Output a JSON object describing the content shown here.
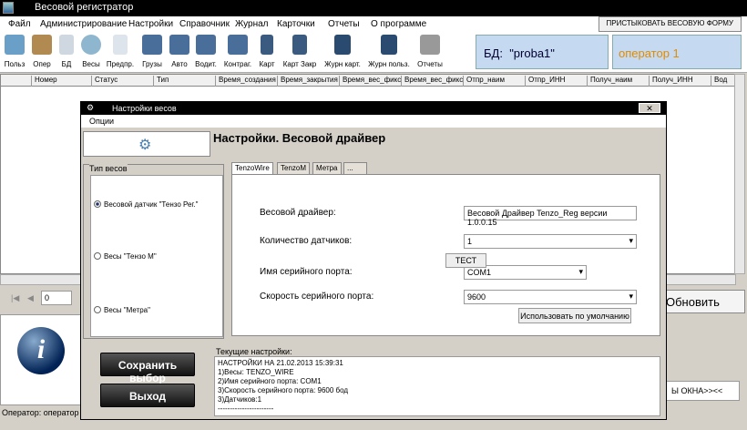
{
  "app": {
    "title": "Весовой регистратор"
  },
  "menu": [
    "Файл",
    "Администрирование",
    "Настройки",
    "Справочник",
    "Журнал",
    "Карточки",
    "Отчеты",
    "О программе"
  ],
  "pin_button": "ПРИСТЫКОВАТЬ ВЕСОВУЮ ФОРМУ",
  "toolbar": [
    {
      "label": "Польз",
      "icon": "users-icon"
    },
    {
      "label": "Опер",
      "icon": "operator-icon"
    },
    {
      "label": "БД",
      "icon": "database-icon"
    },
    {
      "label": "Весы",
      "icon": "scales-gear-icon"
    },
    {
      "label": "Предпр.",
      "icon": "enterprise-icon"
    },
    {
      "label": "Грузы",
      "icon": "cargo-icon"
    },
    {
      "label": "Авто",
      "icon": "auto-icon"
    },
    {
      "label": "Водит.",
      "icon": "driver-icon"
    },
    {
      "label": "Контраг.",
      "icon": "counterparty-icon"
    },
    {
      "label": "Карт",
      "icon": "card-icon"
    },
    {
      "label": "Карт Закр",
      "icon": "card-closed-icon"
    },
    {
      "label": "Журн карт.",
      "icon": "card-journal-icon"
    },
    {
      "label": "Журн польз.",
      "icon": "user-journal-icon"
    },
    {
      "label": "Отчеты",
      "icon": "printer-icon"
    }
  ],
  "db": {
    "label": "БД:",
    "value": "\"proba1\""
  },
  "operator": {
    "value": "оператор 1"
  },
  "grid": {
    "columns": [
      "Номер",
      "Статус",
      "Тип",
      "Время_создания",
      "Время_закрытия",
      "Время_вес_фиксе",
      "Время_вес_фиксе",
      "Отпр_наим",
      "Отпр_ИНН",
      "Получ_наим",
      "Получ_ИНН",
      "Вод"
    ]
  },
  "nav": {
    "page": "0",
    "refresh": "Обновить"
  },
  "status": {
    "operator": "Оператор: оператор"
  },
  "bottom_right": "Ы ОКНА>><<",
  "dialog": {
    "title": "Настройки весов",
    "menu": "Опции",
    "heading": "Настройки.  Весовой драйвер",
    "type_legend": "Тип весов",
    "types": [
      {
        "label": "Весовой датчик \"Тензо Рег.\"",
        "selected": true
      },
      {
        "label": "Весы \"Тензо М\"",
        "selected": false
      },
      {
        "label": "Весы \"Метра\"",
        "selected": false
      }
    ],
    "tabs": [
      "TenzoWire",
      "TenzoM",
      "Метра",
      "..."
    ],
    "fields": {
      "driver_label": "Весовой драйвер:",
      "driver_value": "Весовой Драйвер Tenzo_Reg версии 1.0.0.15",
      "sensors_label": "Количество датчиков:",
      "sensors_value": "1",
      "port_label": "Имя серийного порта:",
      "port_value": "COM1",
      "test": "ТЕСТ",
      "speed_label": "Скорость серийного порта:",
      "speed_value": "9600",
      "default": "Использовать по умолчанию"
    },
    "save": "Сохранить выбор",
    "exit": "Выход",
    "current_label": "Текущие настройки:",
    "current_lines": [
      "НАСТРОЙКИ НА 21.02.2013 15:39:31",
      "1)Весы: TENZO_WIRE",
      "2)Имя серийного порта: COM1",
      "3)Скорость серийного порта: 9600 бод",
      "3)Датчиков:1",
      "-----------------------"
    ]
  }
}
